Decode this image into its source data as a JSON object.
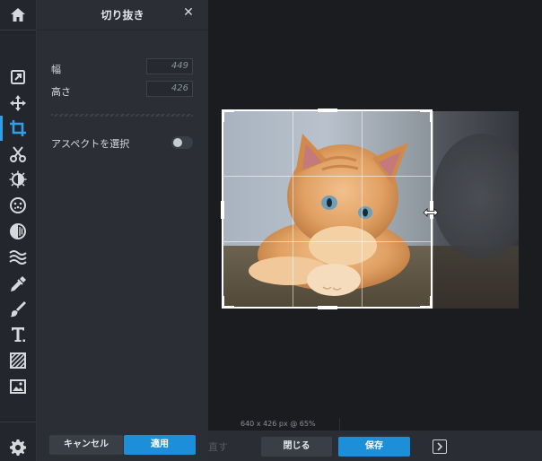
{
  "rail": {
    "icons": [
      "home-icon",
      "resize-icon",
      "move-icon",
      "crop-icon",
      "cut-icon",
      "adjust-icon",
      "effect-icon",
      "filter-icon",
      "liquify-icon",
      "color-picker-icon",
      "brush-icon",
      "text-icon",
      "pattern-icon",
      "image-icon",
      "settings-icon"
    ],
    "active": "crop-icon",
    "accent": "#2f9fe8"
  },
  "panel": {
    "title": "切り抜き",
    "close": "✕",
    "width_label": "幅",
    "width_value": "449",
    "height_label": "高さ",
    "height_value": "426",
    "aspect_label": "アスペクトを選択",
    "aspect_enabled": false,
    "cancel": "キャンセル",
    "apply": "適用"
  },
  "canvas": {
    "status": "640 x 426 px @ 65%",
    "image": "orange-kitten-photo"
  },
  "toolbar": {
    "redo_ghost": "直す",
    "close": "閉じる",
    "save": "保存",
    "panel_toggle_icon": "panel-toggle-icon"
  },
  "colors": {
    "primary": "#1d8fd9",
    "panel_bg": "#2b2e35",
    "canvas_bg": "#1b1c20"
  }
}
